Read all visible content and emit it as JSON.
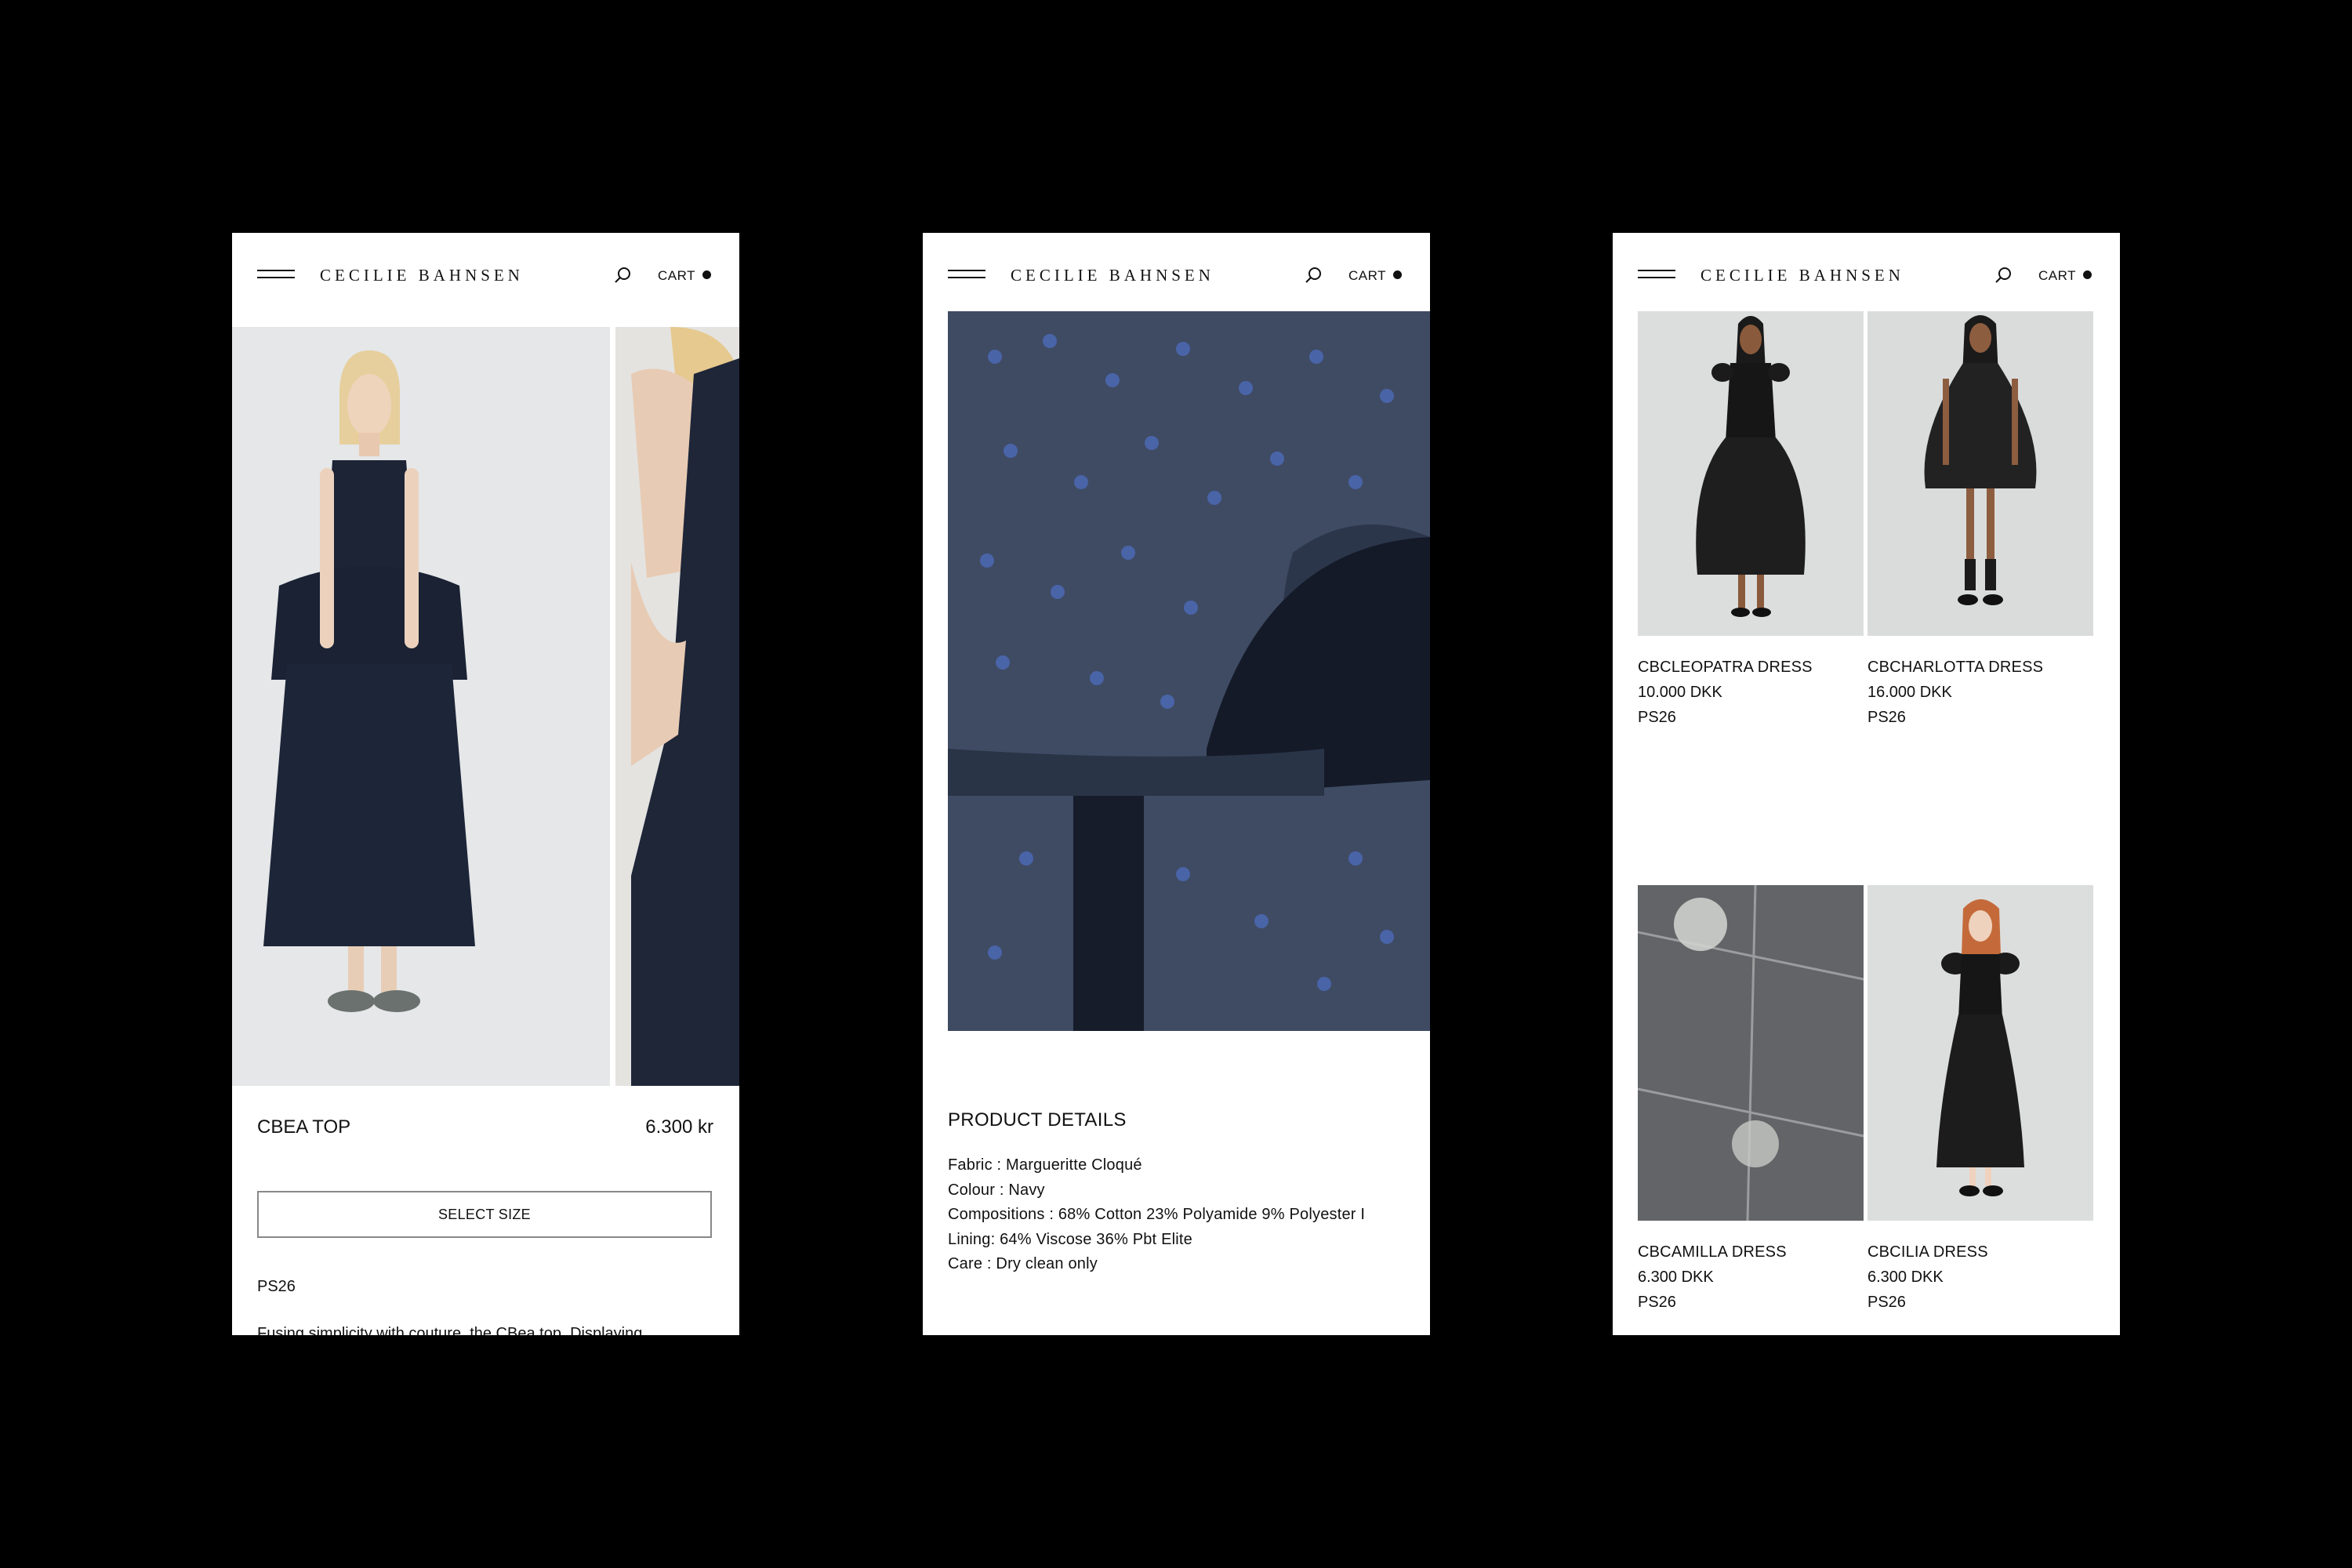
{
  "brand": "CECILIE BAHNSEN",
  "header": {
    "cart_label": "CART"
  },
  "product": {
    "title": "CBEA TOP",
    "price": "6.300 kr",
    "select_size_label": "SELECT SIZE",
    "season": "PS26",
    "description": "Fusing simplicity with couture, the CBea top. Displaying"
  },
  "details": {
    "heading": "PRODUCT DETAILS",
    "lines": [
      "Fabric : Margueritte Cloqué",
      "Colour : Navy",
      "Compositions : 68% Cotton 23% Polyamide 9% Polyester I",
      "Lining: 64% Viscose 36% Pbt Elite",
      "Care : Dry clean only"
    ]
  },
  "listing": [
    {
      "name": "CBCLEOPATRA DRESS",
      "price": "10.000 DKK",
      "season": "PS26"
    },
    {
      "name": "CBCHARLOTTA DRESS",
      "price": "16.000 DKK",
      "season": "PS26"
    },
    {
      "name": "CBCAMILLA DRESS",
      "price": "6.300 DKK",
      "season": "PS26"
    },
    {
      "name": "CBCILIA DRESS",
      "price": "6.300 DKK",
      "season": "PS26"
    }
  ],
  "colors": {
    "background": "#000000",
    "screen": "#ffffff",
    "navy": "#1b2233",
    "text": "#111111"
  },
  "icons": [
    "menu-icon",
    "search-icon",
    "cart-dot-icon"
  ]
}
